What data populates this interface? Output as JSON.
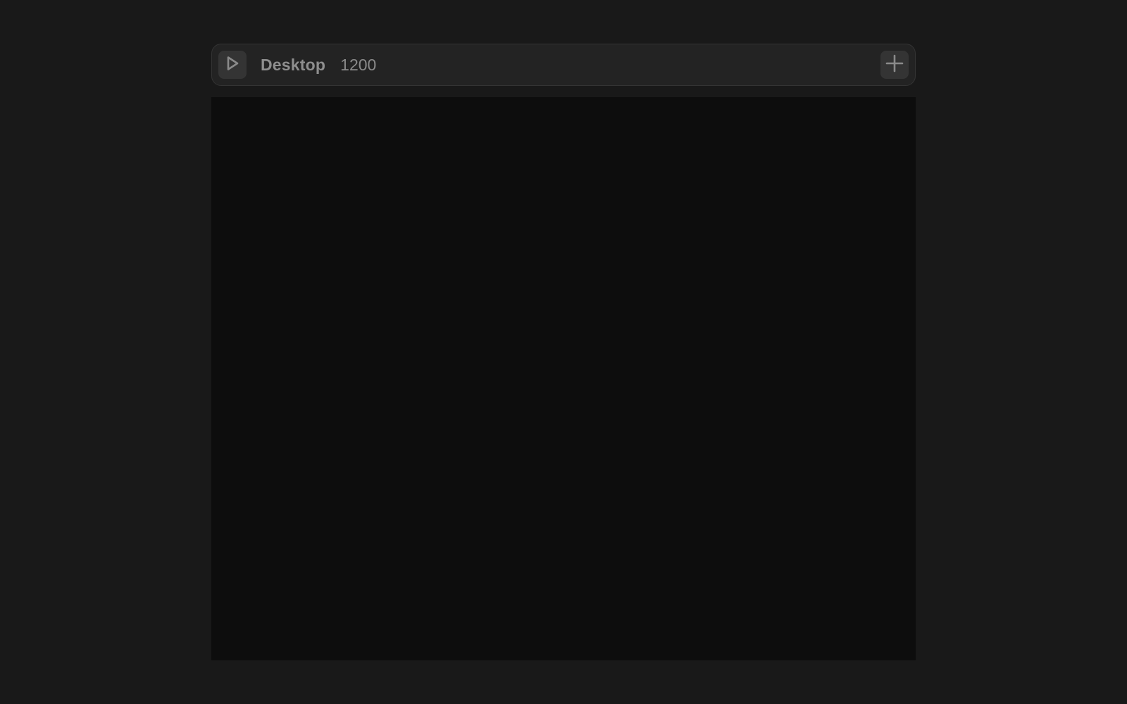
{
  "toolbar": {
    "frame_name": "Desktop",
    "frame_width": "1200",
    "preview_icon": "play-icon",
    "add_icon": "plus-icon"
  },
  "colors": {
    "background": "#191919",
    "toolbar": "#232323",
    "canvas": "#0d0d0d",
    "text": "#8e8e8e"
  }
}
